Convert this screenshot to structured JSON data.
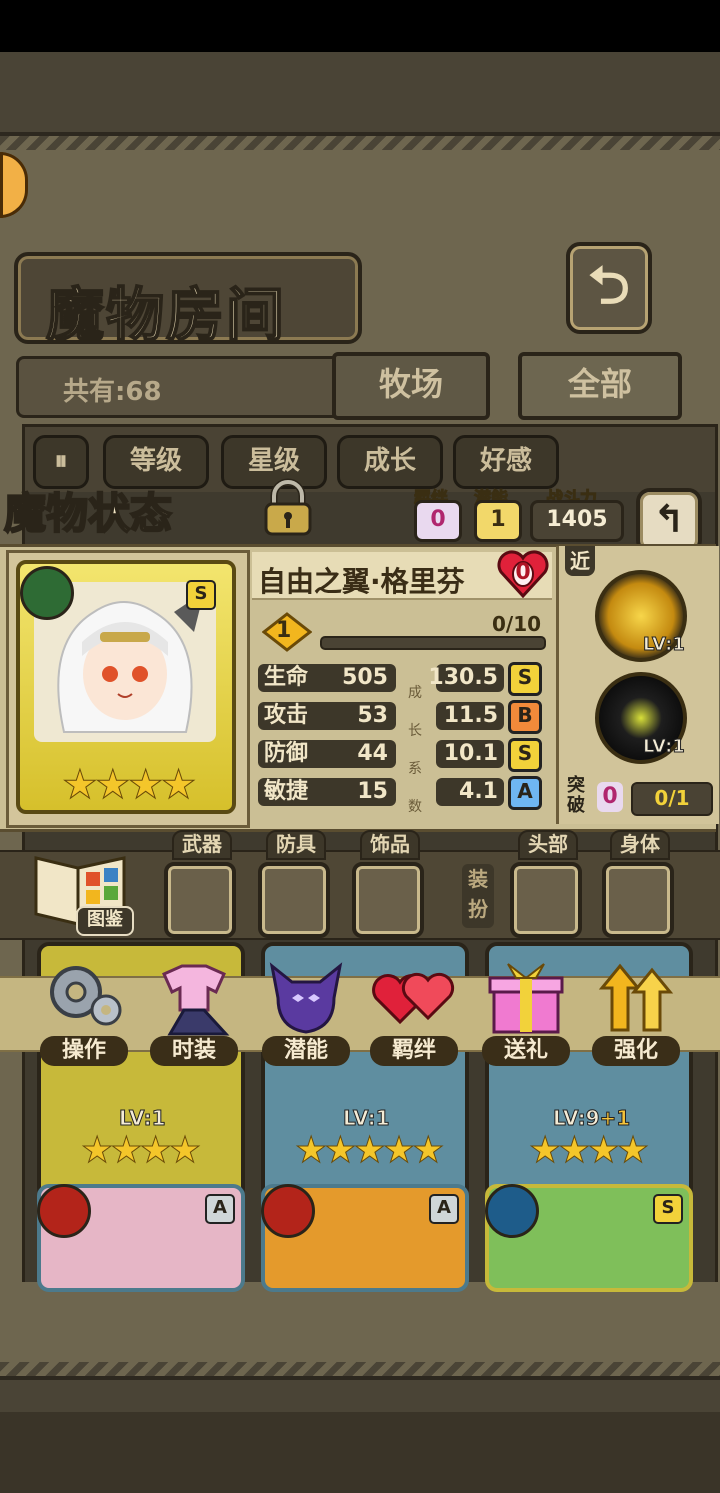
{
  "header": {
    "title": "魔物房间",
    "back_icon": "return-arrow-icon"
  },
  "collection": {
    "count_label": "共有:68"
  },
  "tabs": [
    {
      "label": "牧场"
    },
    {
      "label": "全部"
    }
  ],
  "sort_buttons": [
    {
      "label": "等级"
    },
    {
      "label": "星级"
    },
    {
      "label": "成长"
    },
    {
      "label": "好感"
    }
  ],
  "status": {
    "banner": "魔物状态",
    "bond_label": "羁绊",
    "bond_value": "0",
    "potential_label": "潜能",
    "potential_value": "1",
    "power_label": "战斗力",
    "power_value": "1405"
  },
  "monster": {
    "name": "自由之翼·格里芬",
    "affection": "0",
    "rank": "S",
    "level_badge": "1",
    "exp": "0/10",
    "exp_fraction": 0.0,
    "stars": "★★★★",
    "stats": [
      {
        "label": "生命",
        "value": "505",
        "growth": "130.5",
        "grade": "S",
        "grade_color": "#f2d23a"
      },
      {
        "label": "攻击",
        "value": "53",
        "growth": "11.5",
        "grade": "B",
        "grade_color": "#f28a3a"
      },
      {
        "label": "防御",
        "value": "44",
        "growth": "10.1",
        "grade": "S",
        "grade_color": "#f2d23a"
      },
      {
        "label": "敏捷",
        "value": "15",
        "growth": "4.1",
        "grade": "A",
        "grade_color": "#6fb6f2"
      }
    ],
    "growth_caption": [
      "成",
      "长",
      "系",
      "数"
    ]
  },
  "skills": {
    "range_tag": "近",
    "skill1_level": "LV:1",
    "skill2_level": "LV:1",
    "breakthrough_label": "突破",
    "breakthrough_value": "0",
    "breakthrough_progress": "0/1"
  },
  "equipment": {
    "handbook_label": "图鉴",
    "slots": [
      {
        "label": "武器"
      },
      {
        "label": "防具"
      },
      {
        "label": "饰品"
      },
      {
        "label": "头部"
      },
      {
        "label": "身体"
      }
    ],
    "dress_label_top": "装",
    "dress_label_bottom": "扮"
  },
  "actions": [
    {
      "label": "操作",
      "icon": "gear-icon"
    },
    {
      "label": "时装",
      "icon": "outfit-icon"
    },
    {
      "label": "潜能",
      "icon": "potential-icon"
    },
    {
      "label": "羁绊",
      "icon": "bond-hearts-icon"
    },
    {
      "label": "送礼",
      "icon": "gift-icon"
    },
    {
      "label": "强化",
      "icon": "upgrade-arrows-icon"
    }
  ],
  "cards": [
    {
      "level": "LV:1",
      "stars": "★★★★"
    },
    {
      "level": "LV:1",
      "stars": "★★★★★"
    },
    {
      "level": "LV:9",
      "level_bonus": "+1",
      "stars": "★★★★"
    },
    {
      "rank": "A",
      "element": "fire"
    },
    {
      "rank": "A",
      "element": "fire"
    },
    {
      "rank": "S",
      "element": "water"
    }
  ],
  "colors": {
    "panel": "#6e664f",
    "gold_frame": "#d6c02b",
    "parchment": "#cbbf95"
  }
}
